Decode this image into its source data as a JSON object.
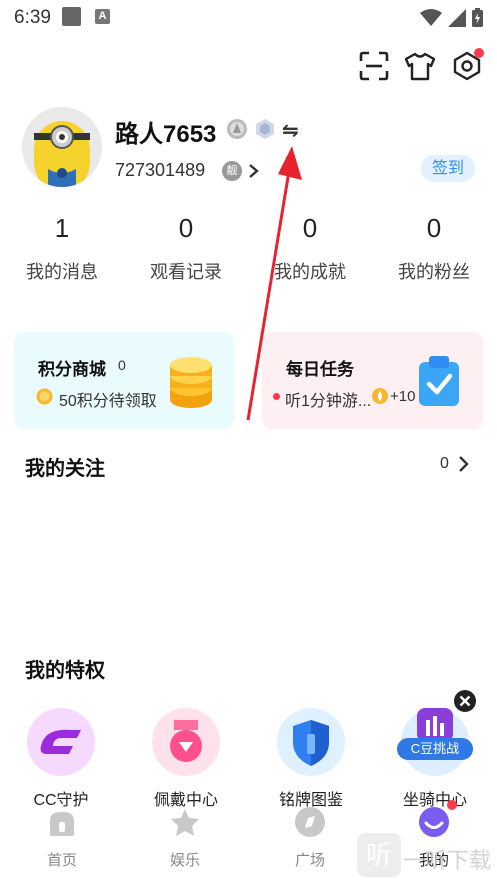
{
  "status_bar": {
    "time": "6:39",
    "a_icon": "A"
  },
  "colors": {
    "accent": "#2f8ef5",
    "badge": "#ff3b4a",
    "arrow": "#e8232f"
  },
  "profile": {
    "name": "路人7653",
    "user_id": "727301489",
    "id_badge": "靓",
    "sign_in_label": "签到",
    "swap_symbol": "⇋"
  },
  "stats": [
    {
      "value": "1",
      "label": "我的消息"
    },
    {
      "value": "0",
      "label": "观看记录"
    },
    {
      "value": "0",
      "label": "我的成就"
    },
    {
      "value": "0",
      "label": "我的粉丝"
    }
  ],
  "cards": {
    "points_mall": {
      "title": "积分商城",
      "count": "0",
      "desc": "50积分待领取"
    },
    "daily_task": {
      "title": "每日任务",
      "desc": "听1分钟游...",
      "reward": "+10"
    }
  },
  "following": {
    "title": "我的关注",
    "count": "0"
  },
  "privileges": {
    "title": "我的特权",
    "items": [
      {
        "label": "CC守护",
        "icon": "cc-guard-icon"
      },
      {
        "label": "佩戴中心",
        "icon": "medal-icon"
      },
      {
        "label": "铭牌图鉴",
        "icon": "shield-icon"
      },
      {
        "label": "坐骑中心",
        "icon": "mount-icon"
      }
    ],
    "popup_label": "C豆挑战"
  },
  "bottom_nav": [
    {
      "label": "首页",
      "icon": "home-icon"
    },
    {
      "label": "娱乐",
      "icon": "star-icon"
    },
    {
      "label": "广场",
      "icon": "compass-icon"
    },
    {
      "label": "我的",
      "icon": "profile-face-icon"
    }
  ],
  "watermark": {
    "text": "一听下载"
  }
}
